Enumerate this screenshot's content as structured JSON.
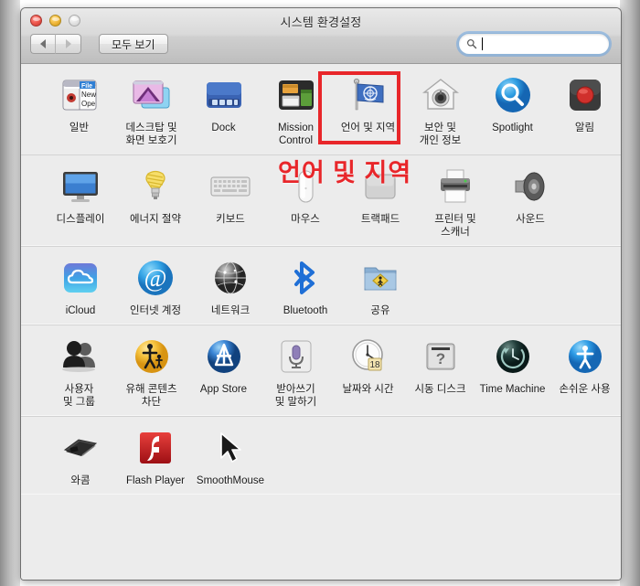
{
  "window": {
    "title": "시스템 환경설정",
    "traffic_lights": [
      {
        "name": "close",
        "color": "#f05c52"
      },
      {
        "name": "minimize",
        "color": "#f4bd43"
      },
      {
        "name": "zoom",
        "color": "#e3e3e3"
      }
    ]
  },
  "toolbar": {
    "back_label": "◀",
    "forward_label": "▶",
    "show_all_label": "모두 보기",
    "search": {
      "value": "",
      "placeholder": ""
    }
  },
  "annotation": {
    "text": "언어 및 지역",
    "color": "#e8262a",
    "highlight_target": "언어 및 지역"
  },
  "rows": [
    {
      "items": [
        {
          "label": "일반",
          "icon": "general-icon"
        },
        {
          "label": "데스크탑 및\n화면 보호기",
          "icon": "desktop-screensaver-icon"
        },
        {
          "label": "Dock",
          "icon": "dock-icon"
        },
        {
          "label": "Mission\nControl",
          "icon": "mission-control-icon"
        },
        {
          "label": "언어 및 지역",
          "icon": "language-region-icon",
          "highlighted": true
        },
        {
          "label": "보안 및\n개인 정보",
          "icon": "security-privacy-icon"
        },
        {
          "label": "Spotlight",
          "icon": "spotlight-icon"
        },
        {
          "label": "알림",
          "icon": "notifications-icon"
        }
      ]
    },
    {
      "items": [
        {
          "label": "디스플레이",
          "icon": "displays-icon"
        },
        {
          "label": "에너지 절약",
          "icon": "energy-saver-icon"
        },
        {
          "label": "키보드",
          "icon": "keyboard-icon"
        },
        {
          "label": "마우스",
          "icon": "mouse-icon"
        },
        {
          "label": "트랙패드",
          "icon": "trackpad-icon"
        },
        {
          "label": "프린터 및\n스캐너",
          "icon": "printers-scanners-icon"
        },
        {
          "label": "사운드",
          "icon": "sound-icon"
        }
      ]
    },
    {
      "items": [
        {
          "label": "iCloud",
          "icon": "icloud-icon"
        },
        {
          "label": "인터넷 계정",
          "icon": "internet-accounts-icon"
        },
        {
          "label": "네트워크",
          "icon": "network-icon"
        },
        {
          "label": "Bluetooth",
          "icon": "bluetooth-icon"
        },
        {
          "label": "공유",
          "icon": "sharing-icon"
        }
      ]
    },
    {
      "items": [
        {
          "label": "사용자\n및 그룹",
          "icon": "users-groups-icon"
        },
        {
          "label": "유해 콘텐츠\n차단",
          "icon": "parental-controls-icon"
        },
        {
          "label": "App Store",
          "icon": "app-store-icon"
        },
        {
          "label": "받아쓰기\n및 말하기",
          "icon": "dictation-speech-icon"
        },
        {
          "label": "날짜와 시간",
          "icon": "date-time-icon"
        },
        {
          "label": "시동 디스크",
          "icon": "startup-disk-icon"
        },
        {
          "label": "Time Machine",
          "icon": "time-machine-icon"
        },
        {
          "label": "손쉬운 사용",
          "icon": "accessibility-icon"
        }
      ]
    },
    {
      "items": [
        {
          "label": "와콤",
          "icon": "wacom-icon"
        },
        {
          "label": "Flash Player",
          "icon": "flash-player-icon"
        },
        {
          "label": "SmoothMouse",
          "icon": "smoothmouse-icon"
        }
      ]
    }
  ]
}
